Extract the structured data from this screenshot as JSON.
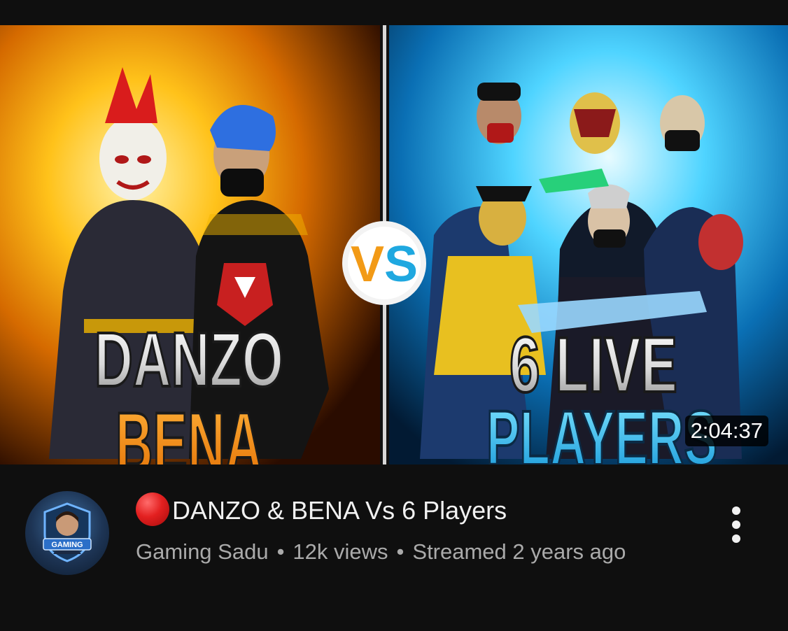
{
  "thumbnail": {
    "left_text_line1": "DANZO",
    "left_text_line2": "BENA",
    "vs_text": "VS",
    "right_text_line1": "6 LIVE",
    "right_text_line2": "PLAYERS",
    "duration": "2:04:37",
    "colors": {
      "left_glow": "#ffb400",
      "right_glow": "#1ec8ff",
      "left_text2": "#f28a0f",
      "right_text2": "#2bc3f0"
    }
  },
  "channel": {
    "avatar_icon": "channel-avatar-gaming",
    "avatar_badge": "GAMING"
  },
  "video": {
    "title": "DANZO & BENA Vs 6 Players",
    "live_icon": "red-circle-icon",
    "channel_name": "Gaming Sadu",
    "views": "12k views",
    "streamed": "Streamed 2 years ago"
  },
  "menu": {
    "icon": "more-vertical-icon"
  }
}
